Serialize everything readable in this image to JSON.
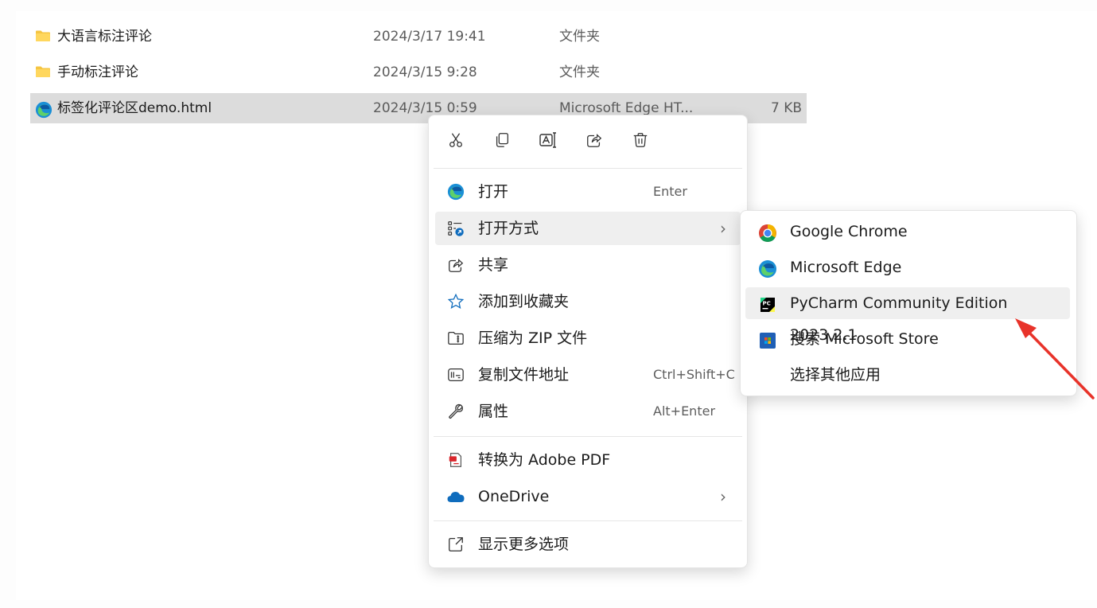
{
  "files": [
    {
      "name": "大语言标注评论",
      "date": "2024/3/17 19:41",
      "type": "文件夹",
      "size": "",
      "icon": "folder-icon"
    },
    {
      "name": "手动标注评论",
      "date": "2024/3/15 9:28",
      "type": "文件夹",
      "size": "",
      "icon": "folder-icon"
    },
    {
      "name": "标签化评论区demo.html",
      "date": "2024/3/15 0:59",
      "type": "Microsoft Edge HT...",
      "size": "7 KB",
      "icon": "edge-icon"
    }
  ],
  "context_menu": {
    "quick_actions": [
      "cut-icon",
      "copy-icon",
      "rename-icon",
      "share-icon",
      "delete-icon"
    ],
    "items": [
      {
        "label": "打开",
        "shortcut": "Enter",
        "icon": "edge-icon"
      },
      {
        "label": "打开方式",
        "shortcut": "",
        "icon": "open-with-icon"
      },
      {
        "label": "共享",
        "shortcut": "",
        "icon": "share-icon"
      },
      {
        "label": "添加到收藏夹",
        "shortcut": "",
        "icon": "star-icon"
      },
      {
        "label": "压缩为 ZIP 文件",
        "shortcut": "",
        "icon": "zip-icon"
      },
      {
        "label": "复制文件地址",
        "shortcut": "Ctrl+Shift+C",
        "icon": "copy-path-icon"
      },
      {
        "label": "属性",
        "shortcut": "Alt+Enter",
        "icon": "wrench-icon"
      },
      {
        "label": "转换为 Adobe PDF",
        "shortcut": "",
        "icon": "pdf-icon"
      },
      {
        "label": "OneDrive",
        "shortcut": "",
        "icon": "onedrive-icon"
      },
      {
        "label": "显示更多选项",
        "shortcut": "",
        "icon": "more-options-icon"
      }
    ]
  },
  "open_with_submenu": {
    "items": [
      {
        "label": "Google Chrome",
        "icon": "chrome-icon"
      },
      {
        "label": "Microsoft Edge",
        "icon": "edge-icon"
      },
      {
        "label": "PyCharm Community Edition 2023.2.1",
        "icon": "pycharm-icon"
      },
      {
        "label": "搜索 Microsoft Store",
        "icon": "store-icon"
      },
      {
        "label": "选择其他应用",
        "icon": ""
      }
    ]
  },
  "colors": {
    "selection": "#dcdcdc",
    "hover": "#efefef",
    "accent_arrow": "#e8332a",
    "folder": "#f5c542",
    "edge": "#1a8fd6"
  }
}
